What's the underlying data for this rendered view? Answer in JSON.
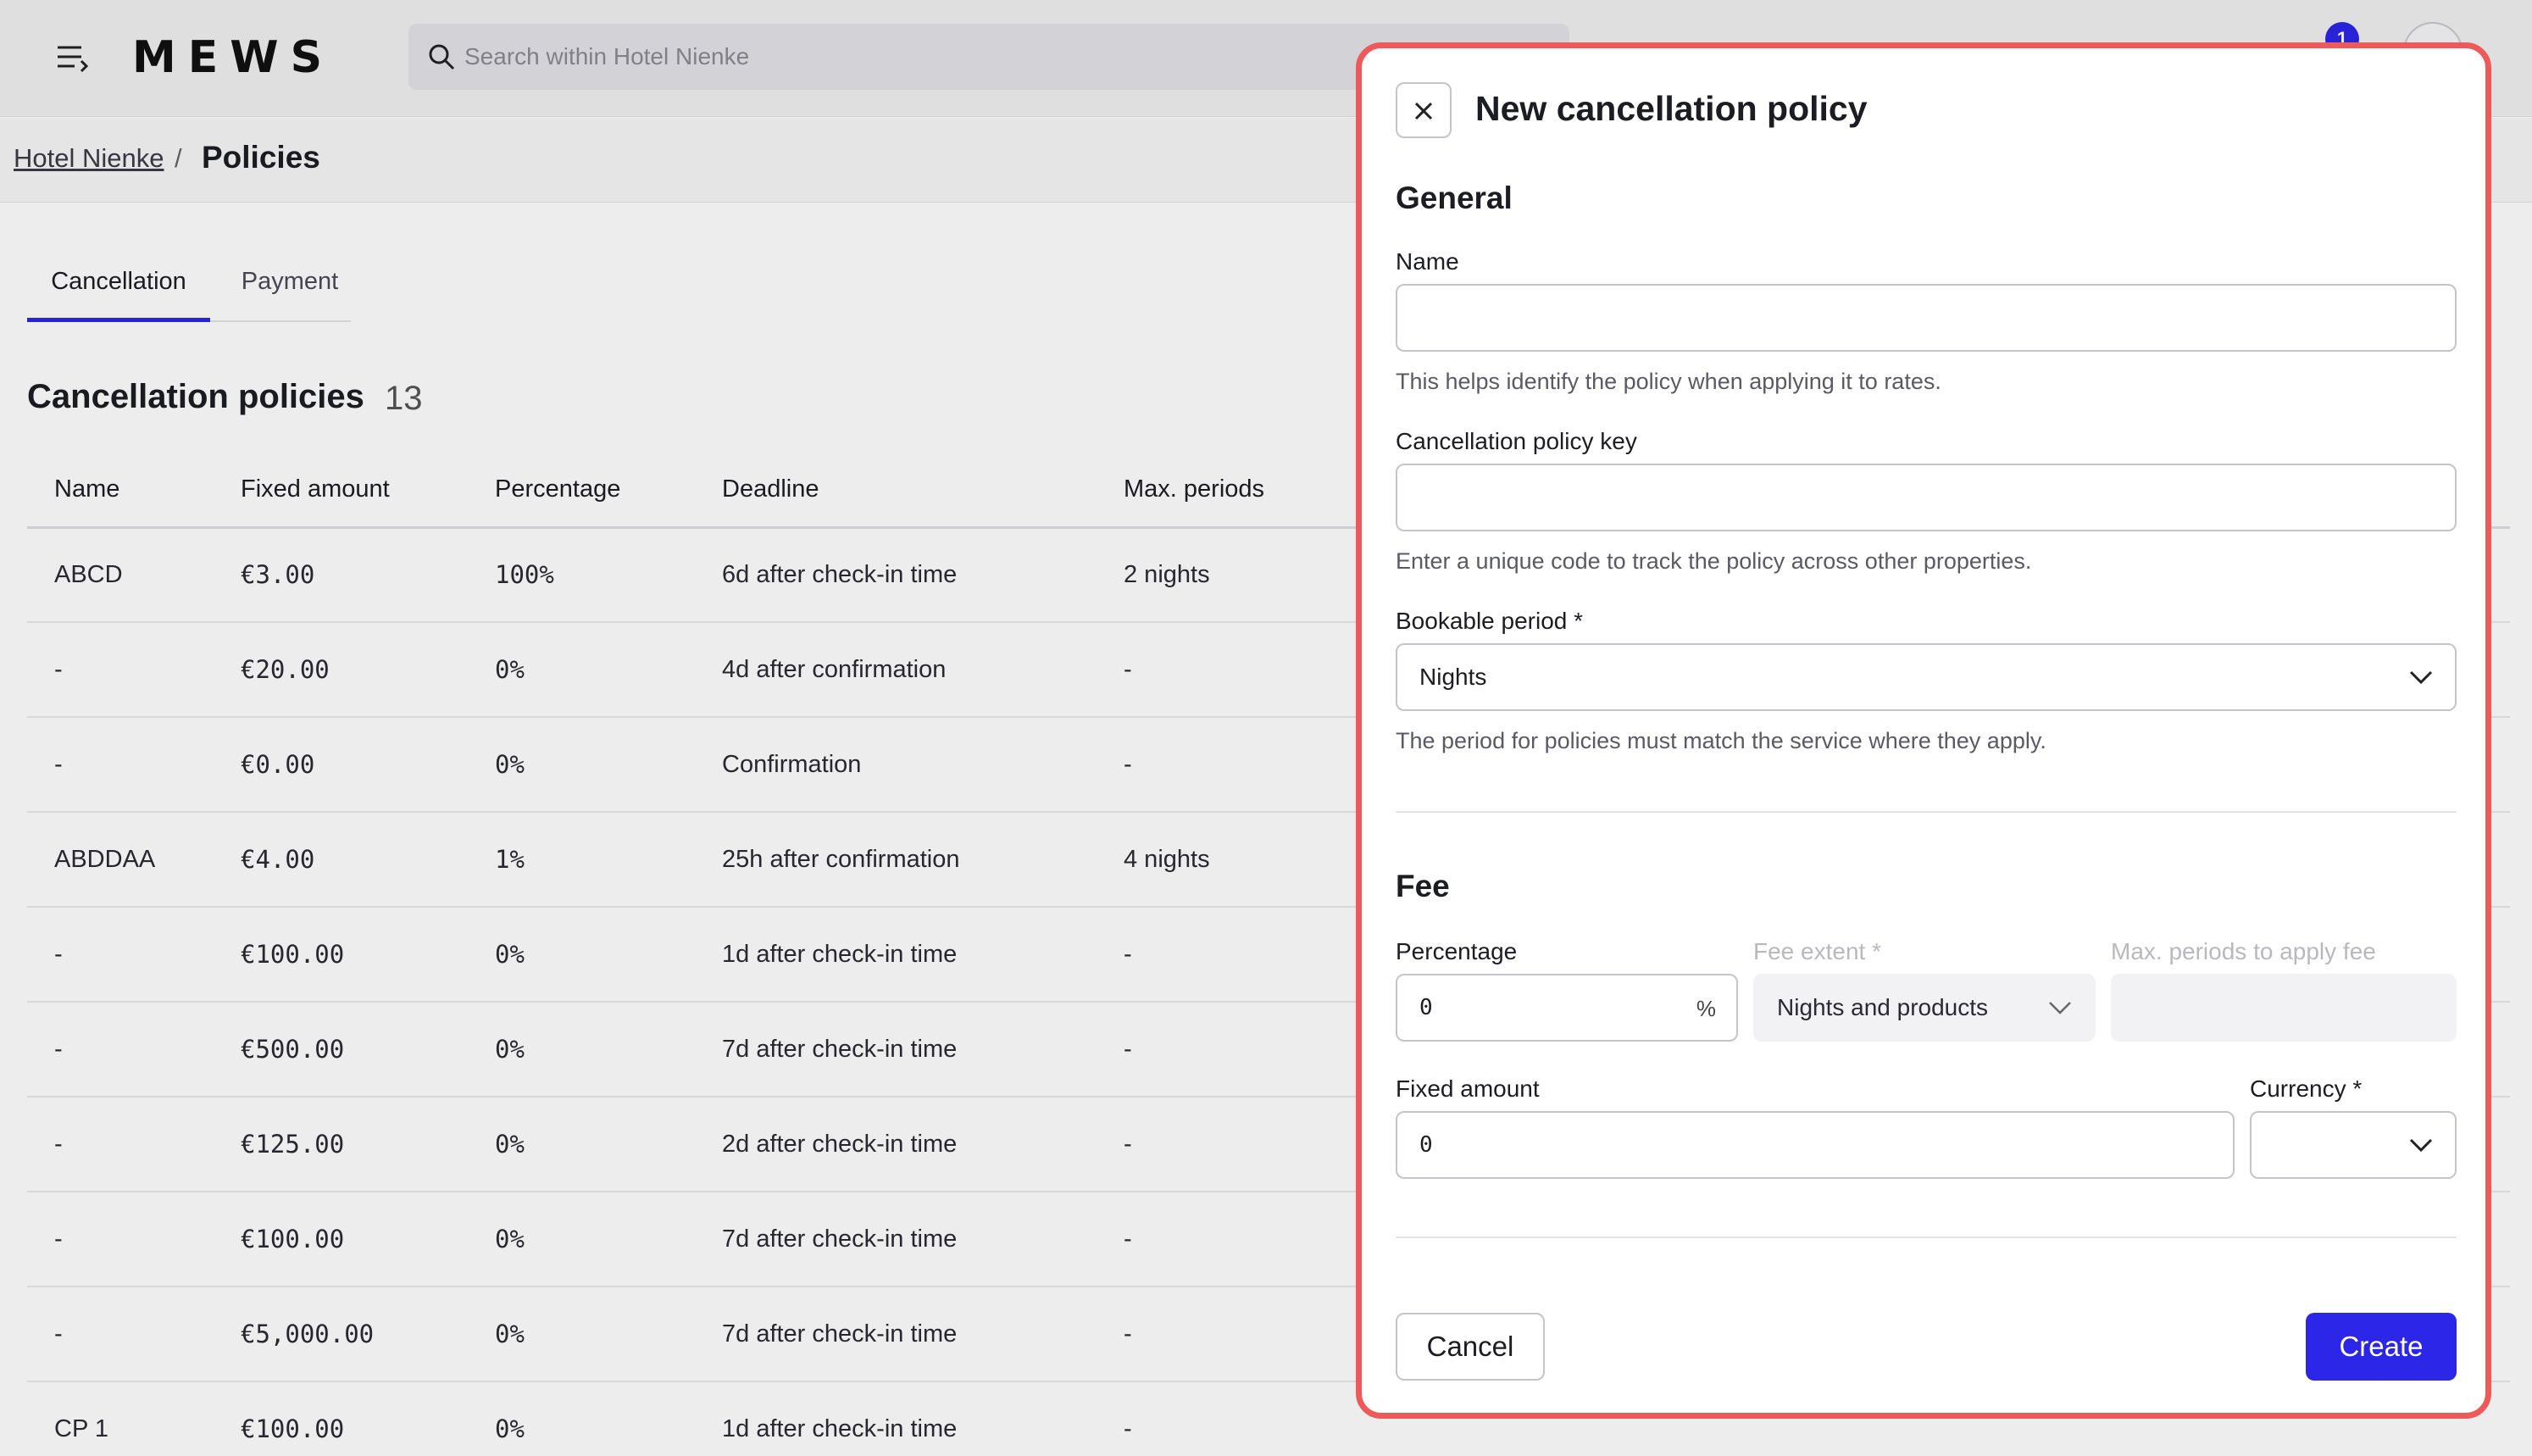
{
  "header": {
    "logo": "MEWS",
    "search_placeholder": "Search within Hotel Nienke",
    "notifications_count": "1"
  },
  "breadcrumb": {
    "parent": "Hotel Nienke",
    "separator": "/",
    "current": "Policies"
  },
  "tabs": [
    {
      "label": "Cancellation",
      "active": true
    },
    {
      "label": "Payment",
      "active": false
    }
  ],
  "list": {
    "title": "Cancellation policies",
    "count": "13",
    "columns": [
      "Name",
      "Fixed amount",
      "Percentage",
      "Deadline",
      "Max. periods"
    ],
    "rows": [
      {
        "name": "ABCD",
        "fixed": "€3.00",
        "pct": "100%",
        "deadline": "6d after check-in time",
        "max": "2 nights"
      },
      {
        "name": "-",
        "fixed": "€20.00",
        "pct": "0%",
        "deadline": "4d after confirmation",
        "max": "-"
      },
      {
        "name": "-",
        "fixed": "€0.00",
        "pct": "0%",
        "deadline": "Confirmation",
        "max": "-"
      },
      {
        "name": "ABDDAA",
        "fixed": "€4.00",
        "pct": "1%",
        "deadline": "25h after confirmation",
        "max": "4 nights"
      },
      {
        "name": "-",
        "fixed": "€100.00",
        "pct": "0%",
        "deadline": "1d after check-in time",
        "max": "-"
      },
      {
        "name": "-",
        "fixed": "€500.00",
        "pct": "0%",
        "deadline": "7d after check-in time",
        "max": "-"
      },
      {
        "name": "-",
        "fixed": "€125.00",
        "pct": "0%",
        "deadline": "2d after check-in time",
        "max": "-"
      },
      {
        "name": "-",
        "fixed": "€100.00",
        "pct": "0%",
        "deadline": "7d after check-in time",
        "max": "-"
      },
      {
        "name": "-",
        "fixed": "€5,000.00",
        "pct": "0%",
        "deadline": "7d after check-in time",
        "max": "-"
      },
      {
        "name": "CP 1",
        "fixed": "€100.00",
        "pct": "0%",
        "deadline": "1d after check-in time",
        "max": "-"
      }
    ]
  },
  "dialog": {
    "title": "New cancellation policy",
    "close_icon": "close-icon",
    "general": {
      "title": "General",
      "name_label": "Name",
      "name_value": "",
      "name_hint": "This helps identify the policy when applying it to rates.",
      "key_label": "Cancellation policy key",
      "key_value": "",
      "key_hint": "Enter a unique code to track the policy across other properties.",
      "period_label": "Bookable period *",
      "period_value": "Nights",
      "period_hint": "The period for policies must match the service where they apply."
    },
    "fee": {
      "title": "Fee",
      "percentage_label": "Percentage",
      "percentage_value": "0",
      "percentage_suffix": "%",
      "extent_label": "Fee extent *",
      "extent_value": "Nights and products",
      "max_periods_label": "Max. periods to apply fee",
      "fixed_label": "Fixed amount",
      "fixed_value": "0",
      "currency_label": "Currency *",
      "currency_value": ""
    },
    "cancel_label": "Cancel",
    "create_label": "Create"
  },
  "colors": {
    "accent": "#2c26e8",
    "dialog_highlight": "#ee5a5a"
  }
}
